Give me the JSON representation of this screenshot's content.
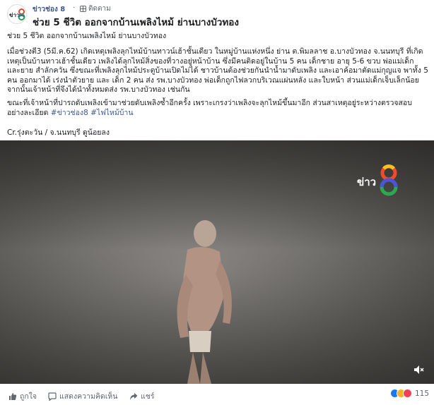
{
  "header": {
    "page_name": "ข่าวช่อง 8",
    "separator": "·",
    "follow_label": "ติดตาม",
    "avatar_text": "ข่าว",
    "title": "ช่วย 5 ชีวิต ออกจากบ้านเพลิงไหม้ ย่านบางบัวทอง"
  },
  "post": {
    "subtitle": "ช่วย 5 ชีวิต ออกจากบ้านเพลิงไหม้ ย่านบางบัวทอง",
    "body": "เมื่อช่วงตี3 (5มี.ค.62) เกิดเหตุเพลิงลุกไหม้บ้านทาวน์เฮ้าชั้นเดียว ในหมู่บ้านแห่งหนึ่ง ย่าน ต.พิมลลาช อ.บางบัวทอง จ.นนทบุรี ที่เกิดเหตุเป็นบ้านทาวเฮ้าชั้นเดียว เพลิงได้ลุกไหม้สิ่งของที่วางอยู่หน้าบ้าน ซึ่งมีคนติดอยู่ในบ้าน 5 คน เด็กชาย อายุ 5-6 ขวบ พ่อแม่เด็ก และยาย สำลักควัน ซึ่งขณะที่เพลิงลุกไหม้ประตูบ้านเปิดไม่ได้ ชาวบ้านต้องช่วยกันนำน้ำมาดับเพลิง และเอาค้อมาตัดแม่กุญแจ พาทั้ง 5 คน ออกมาได้ เร่งนำตัวยาย และ เด็ก 2 คน ส่ง รพ.บางบัวทอง พ่อเด็กถูกไฟลวกบริเวณแผ่นหลัง และใบหน้า ส่วนแม่เด็กเจ็บเล็กน้อย จากนั้นเจ้าหน้าที่จึงได้นำทั้งหมดส่ง รพ.บางบัวทอง เช่นกัน",
    "body2": "ขณะที่เจ้าหน้าที่ปารถดับเพลิงเข้ามาช่วยดับเพลิงซ้ำอีกครั้ง เพราะเกรงว่าเพลิงจะลุกไหม้ขึ้นมาอีก ส่วนสาเหตุอยู่ระหว่างตรวจสอบอย่างละเอียด ",
    "hashtag1": "#ข่าวช่อง8",
    "hashtag2": "#ไฟไหม้บ้าน",
    "credit": "Cr.รุ่งตะวัน / จ.นนทบุรี ดูน้อยลง"
  },
  "video": {
    "watermark": "ข่าว",
    "volume_icon": "volume-muted-icon"
  },
  "actions": {
    "like_label": "ถูกใจ",
    "comment_label": "แสดงความคิดเห็น",
    "share_label": "แชร์",
    "reaction_count": "115"
  },
  "colors": {
    "link": "#385898",
    "like_blue": "#1877f2",
    "love_red": "#f33e58",
    "haha_yellow": "#f7b125"
  }
}
